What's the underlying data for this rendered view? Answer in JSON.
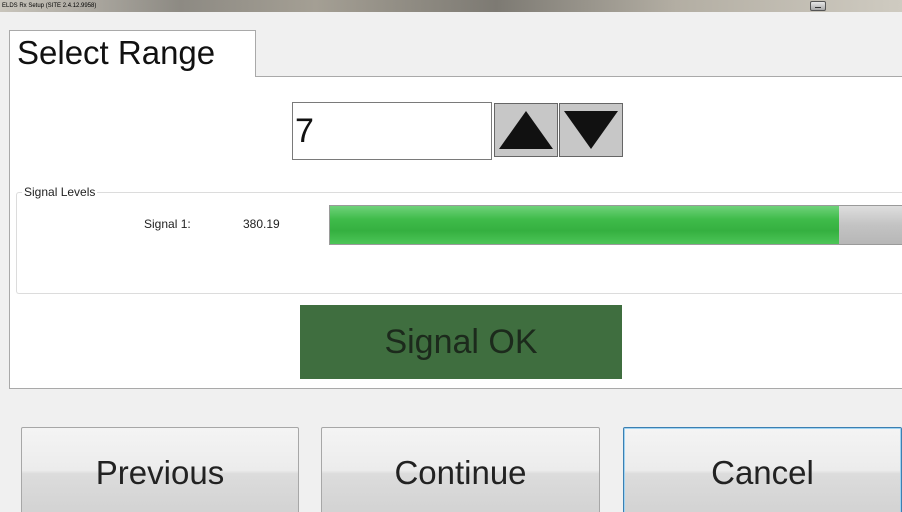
{
  "window": {
    "title": "ELDS Rx Setup (SITE 2.4.12.9958)"
  },
  "tab": {
    "label": "Select Range"
  },
  "range": {
    "value": "7"
  },
  "signal_levels": {
    "group_label": "Signal Levels",
    "signals": [
      {
        "label": "Signal 1:",
        "value": "380.19",
        "level_fraction": 0.89,
        "fill_color": "#3fbb4a"
      }
    ]
  },
  "status": {
    "text": "Signal OK",
    "color": "#3f6e3f"
  },
  "buttons": {
    "previous": "Previous",
    "continue": "Continue",
    "cancel": "Cancel"
  },
  "icons": {
    "up": "triangle-up-icon",
    "down": "triangle-down-icon"
  }
}
